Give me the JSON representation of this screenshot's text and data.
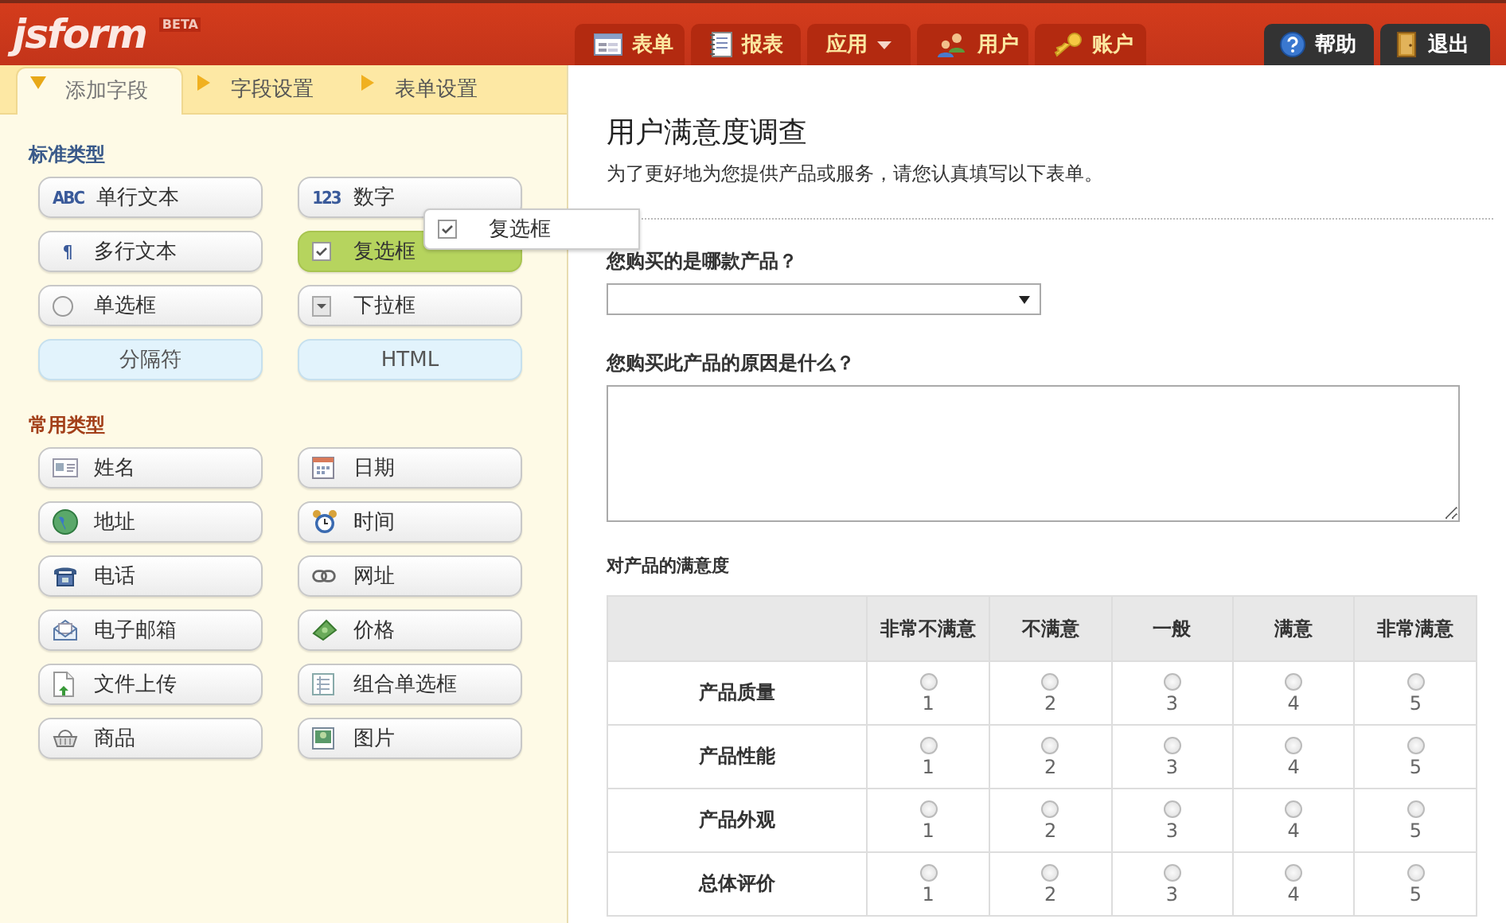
{
  "logo": {
    "name": "jsform",
    "badge": "BETA"
  },
  "nav": [
    {
      "label": "表单"
    },
    {
      "label": "报表"
    },
    {
      "label": "应用",
      "dropdown": true
    },
    {
      "label": "用户"
    },
    {
      "label": "账户"
    }
  ],
  "nav_right": [
    {
      "label": "帮助"
    },
    {
      "label": "退出"
    }
  ],
  "panel_tabs": [
    {
      "label": "添加字段",
      "selected": true
    },
    {
      "label": "字段设置",
      "selected": false
    },
    {
      "label": "表单设置",
      "selected": false
    }
  ],
  "sections": [
    {
      "title": "标准类型",
      "items": [
        {
          "label": "单行文本",
          "glyph": "ABC",
          "kind": "field",
          "selected": false
        },
        {
          "label": "数字",
          "glyph": "123",
          "kind": "field",
          "selected": false
        },
        {
          "label": "多行文本",
          "glyph": "¶",
          "kind": "field",
          "selected": false
        },
        {
          "label": "复选框",
          "kind": "field",
          "selected": true
        },
        {
          "label": "单选框",
          "kind": "field",
          "selected": false
        },
        {
          "label": "下拉框",
          "kind": "field",
          "selected": false
        },
        {
          "label": "分隔符",
          "kind": "plain",
          "selected": false
        },
        {
          "label": "HTML",
          "kind": "plain",
          "selected": false
        }
      ]
    },
    {
      "title": "常用类型",
      "items": [
        {
          "label": "姓名",
          "kind": "field",
          "selected": false
        },
        {
          "label": "日期",
          "kind": "field",
          "selected": false
        },
        {
          "label": "地址",
          "kind": "field",
          "selected": false
        },
        {
          "label": "时间",
          "kind": "field",
          "selected": false
        },
        {
          "label": "电话",
          "kind": "field",
          "selected": false
        },
        {
          "label": "网址",
          "kind": "field",
          "selected": false
        },
        {
          "label": "电子邮箱",
          "kind": "field",
          "selected": false
        },
        {
          "label": "价格",
          "kind": "field",
          "selected": false
        },
        {
          "label": "文件上传",
          "kind": "field",
          "selected": false
        },
        {
          "label": "组合单选框",
          "kind": "field",
          "selected": false
        },
        {
          "label": "商品",
          "kind": "field",
          "selected": false
        },
        {
          "label": "图片",
          "kind": "field",
          "selected": false
        }
      ]
    }
  ],
  "drag_ghost": {
    "label": "复选框"
  },
  "form": {
    "title": "用户满意度调查",
    "description": "为了更好地为您提供产品或服务，请您认真填写以下表单。",
    "questions": [
      {
        "kind": "select",
        "label": "您购买的是哪款产品？"
      },
      {
        "kind": "textarea",
        "label": "您购买此产品的原因是什么？"
      },
      {
        "kind": "matrix",
        "label": "对产品的满意度",
        "columns": [
          "非常不满意",
          "不满意",
          "一般",
          "满意",
          "非常满意"
        ],
        "rows": [
          {
            "label": "产品质量",
            "options": [
              {
                "value": "1",
                "selected": false
              },
              {
                "value": "2",
                "selected": false
              },
              {
                "value": "3",
                "selected": false
              },
              {
                "value": "4",
                "selected": false
              },
              {
                "value": "5",
                "selected": false
              }
            ]
          },
          {
            "label": "产品性能",
            "options": [
              {
                "value": "1",
                "selected": false
              },
              {
                "value": "2",
                "selected": false
              },
              {
                "value": "3",
                "selected": false
              },
              {
                "value": "4",
                "selected": false
              },
              {
                "value": "5",
                "selected": false
              }
            ]
          },
          {
            "label": "产品外观",
            "options": [
              {
                "value": "1",
                "selected": false
              },
              {
                "value": "2",
                "selected": false
              },
              {
                "value": "3",
                "selected": false
              },
              {
                "value": "4",
                "selected": false
              },
              {
                "value": "5",
                "selected": false
              }
            ]
          },
          {
            "label": "总体评价",
            "options": [
              {
                "value": "1",
                "selected": false
              },
              {
                "value": "2",
                "selected": false
              },
              {
                "value": "3",
                "selected": false
              },
              {
                "value": "4",
                "selected": false
              },
              {
                "value": "5",
                "selected": false
              }
            ]
          }
        ]
      }
    ]
  }
}
